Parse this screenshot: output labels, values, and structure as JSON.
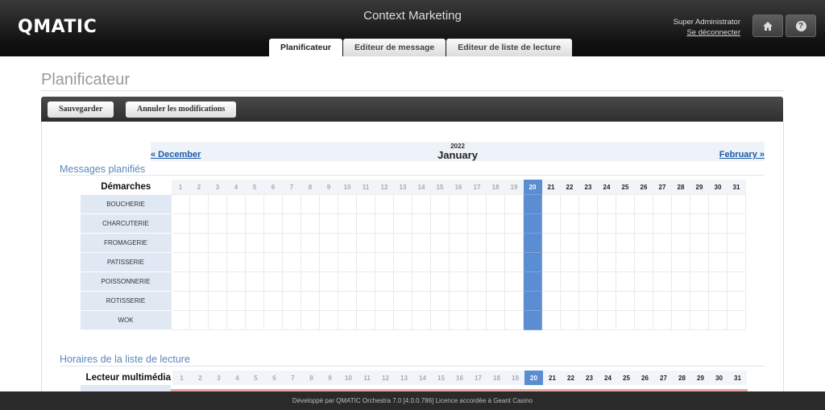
{
  "header": {
    "logo": "QMATIC",
    "app_title": "Context Marketing",
    "tabs": [
      {
        "label": "Planificateur",
        "active": true
      },
      {
        "label": "Editeur de message",
        "active": false
      },
      {
        "label": "Editeur de liste de lecture",
        "active": false
      }
    ],
    "user_name": "Super Administrator",
    "logout_label": "Se déconnecter",
    "home_icon": "home-icon",
    "help_icon": "help-icon"
  },
  "page": {
    "title": "Planificateur",
    "save_label": "Sauvegarder",
    "cancel_label": "Annuler les modifications"
  },
  "calendar": {
    "year": "2022",
    "month": "January",
    "prev_label": "« December",
    "next_label": "February »",
    "today": 20,
    "days": [
      "1",
      "2",
      "3",
      "4",
      "5",
      "6",
      "7",
      "8",
      "9",
      "10",
      "11",
      "12",
      "13",
      "14",
      "15",
      "16",
      "17",
      "18",
      "19",
      "20",
      "21",
      "22",
      "23",
      "24",
      "25",
      "26",
      "27",
      "28",
      "29",
      "30",
      "31"
    ]
  },
  "scheduled_messages": {
    "title": "Messages planifiés",
    "column_header": "Démarches",
    "rows": [
      "BOUCHERIE",
      "CHARCUTERIE",
      "FROMAGERIE",
      "PATISSERIE",
      "POISSONNERIE",
      "ROTISSERIE",
      "WOK"
    ]
  },
  "playlist_hours": {
    "title": "Horaires de la liste de lecture",
    "column_header": "Lecteur multimédia"
  },
  "footer": {
    "text": "Développé par QMATIC Orchestra 7.0 [4.0.0.786] Licence accordée à Geant Casino"
  },
  "colors": {
    "today_highlight": "#5b8dd3",
    "link": "#1c5aa6",
    "section_title": "#5d87bd"
  }
}
